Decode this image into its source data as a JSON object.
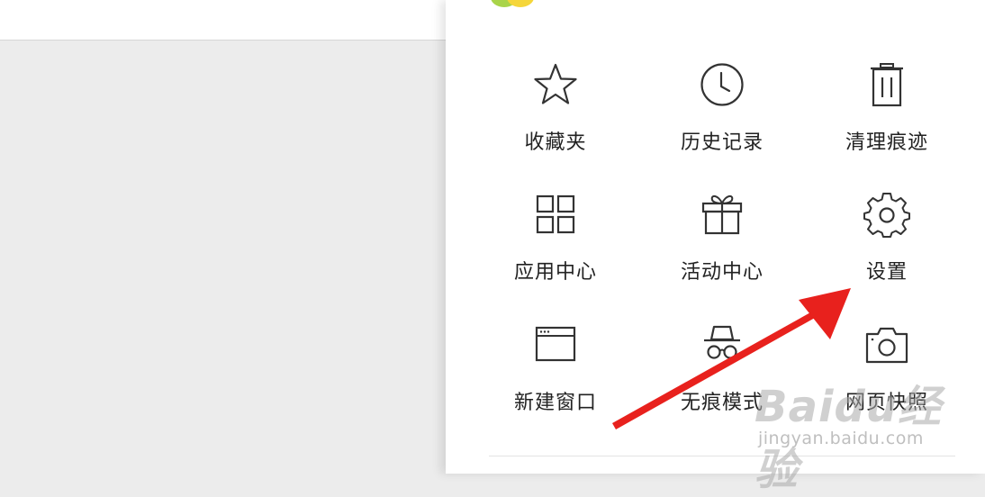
{
  "menu": {
    "items": [
      {
        "id": "favorites",
        "label": "收藏夹",
        "icon": "star-icon"
      },
      {
        "id": "history",
        "label": "历史记录",
        "icon": "clock-icon"
      },
      {
        "id": "clear-traces",
        "label": "清理痕迹",
        "icon": "trash-icon"
      },
      {
        "id": "app-center",
        "label": "应用中心",
        "icon": "grid-icon"
      },
      {
        "id": "activity-center",
        "label": "活动中心",
        "icon": "gift-icon"
      },
      {
        "id": "settings",
        "label": "设置",
        "icon": "gear-icon"
      },
      {
        "id": "new-window",
        "label": "新建窗口",
        "icon": "window-icon"
      },
      {
        "id": "incognito",
        "label": "无痕模式",
        "icon": "incognito-icon"
      },
      {
        "id": "snapshot",
        "label": "网页快照",
        "icon": "camera-icon"
      }
    ]
  },
  "annotation": {
    "arrow_color": "#e8211d",
    "points_to": "settings"
  },
  "watermark": {
    "logo": "Baidu经验",
    "url": "jingyan.baidu.com"
  }
}
